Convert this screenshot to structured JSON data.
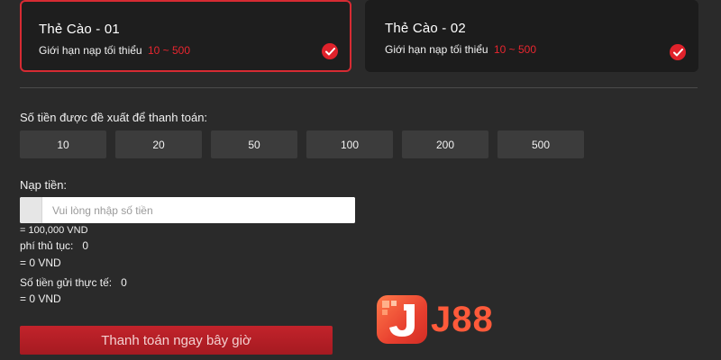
{
  "cards": [
    {
      "title": "Thẻ Cào - 01",
      "limit_label": "Giới hạn nạp tối thiểu",
      "range": "10 ~ 500",
      "selected": true
    },
    {
      "title": "Thẻ Cào - 02",
      "limit_label": "Giới hạn nạp tối thiểu",
      "range": "10 ~ 500",
      "selected": false
    }
  ],
  "suggest": {
    "label": "Số tiền được đề xuất để thanh toán:",
    "amounts": [
      "10",
      "20",
      "50",
      "100",
      "200",
      "500"
    ]
  },
  "deposit": {
    "label": "Nạp tiền:",
    "placeholder": "Vui lòng nhập số tiền",
    "value": ""
  },
  "info": {
    "rate": "= 100,000 VND",
    "fee_label": "phí thủ tục:",
    "fee_value": "0",
    "fee_vnd": "= 0 VND",
    "actual_label": "Số tiền gửi thực tế:",
    "actual_value": "0",
    "actual_vnd": "= 0 VND"
  },
  "pay_button": "Thanh toán ngay bây giờ",
  "logo": {
    "text": "J88"
  },
  "colors": {
    "accent": "#d62b33",
    "range": "#e8262f",
    "background": "#2a2a2a",
    "card": "#1c1c1c",
    "amount_button": "#3c3c3c"
  }
}
